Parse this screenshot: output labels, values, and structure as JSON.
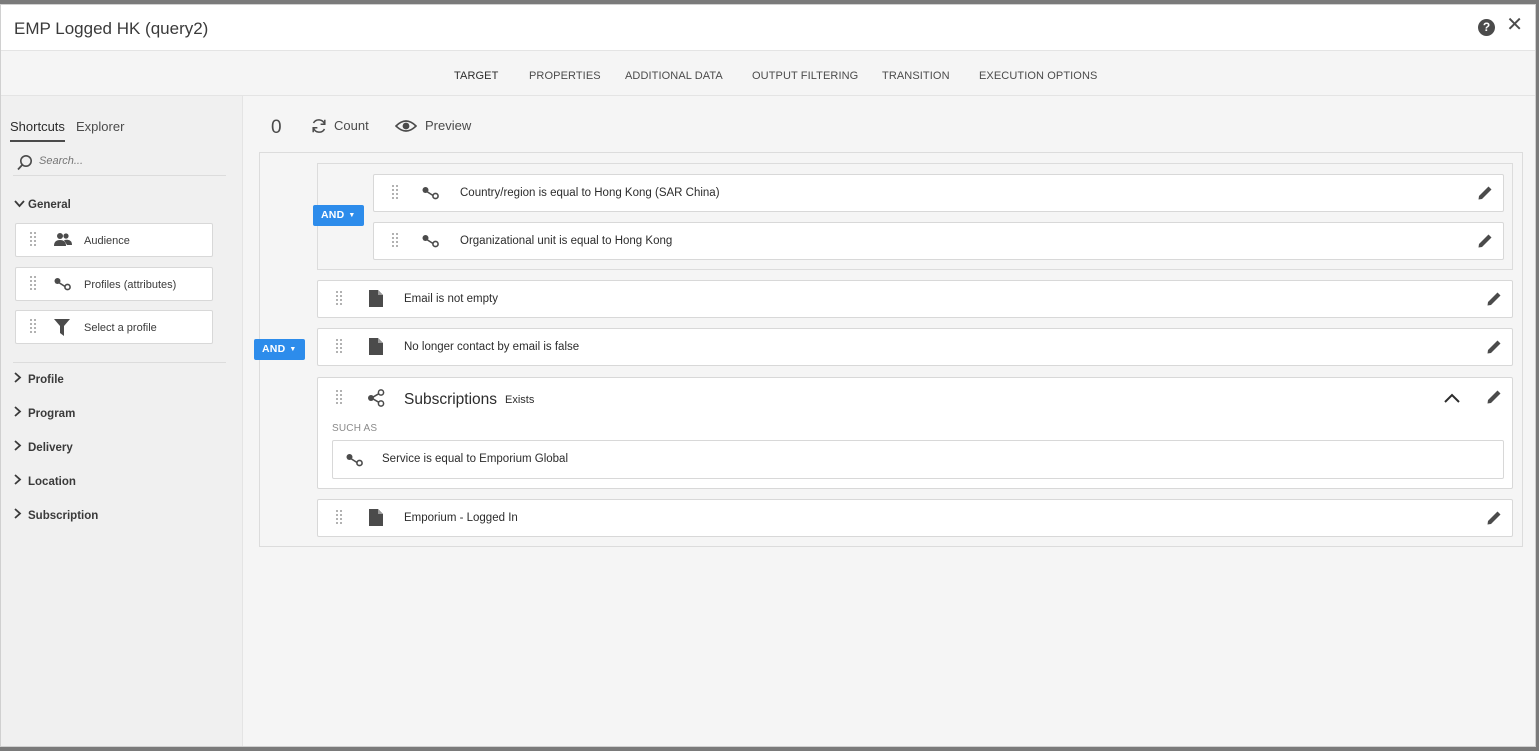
{
  "window": {
    "title": "EMP Logged HK (query2)",
    "help_icon": "?",
    "close_icon": "✕"
  },
  "tabs": [
    {
      "label": "TARGET",
      "active": true
    },
    {
      "label": "PROPERTIES"
    },
    {
      "label": "ADDITIONAL DATA"
    },
    {
      "label": "OUTPUT FILTERING"
    },
    {
      "label": "TRANSITION"
    },
    {
      "label": "EXECUTION OPTIONS"
    }
  ],
  "sidebar": {
    "tabs": [
      {
        "label": "Shortcuts",
        "active": true
      },
      {
        "label": "Explorer"
      }
    ],
    "search_placeholder": "Search...",
    "general": {
      "label": "General",
      "items": [
        {
          "label": "Audience",
          "icon": "audience-icon"
        },
        {
          "label": "Profiles (attributes)",
          "icon": "link-icon"
        },
        {
          "label": "Select a profile",
          "icon": "filter-icon"
        }
      ]
    },
    "sections": [
      "Profile",
      "Program",
      "Delivery",
      "Location",
      "Subscription"
    ]
  },
  "toolbar": {
    "count_value": "0",
    "count_label": "Count",
    "preview_label": "Preview"
  },
  "query": {
    "outer_operator": "AND",
    "inner_operator": "AND",
    "inner_rules": [
      "Country/region is equal to Hong Kong (SAR China)",
      "Organizational unit is equal to Hong Kong"
    ],
    "rules": [
      "Email is not empty",
      "No longer contact by email is false"
    ],
    "subscriptions": {
      "title": "Subscriptions",
      "qualifier": "Exists",
      "such_as_label": "SUCH AS",
      "condition": "Service is equal to Emporium Global"
    },
    "last_rule": "Emporium - Logged In"
  },
  "colors": {
    "accent": "#2d8ceb",
    "icon": "#4b4b4b"
  }
}
